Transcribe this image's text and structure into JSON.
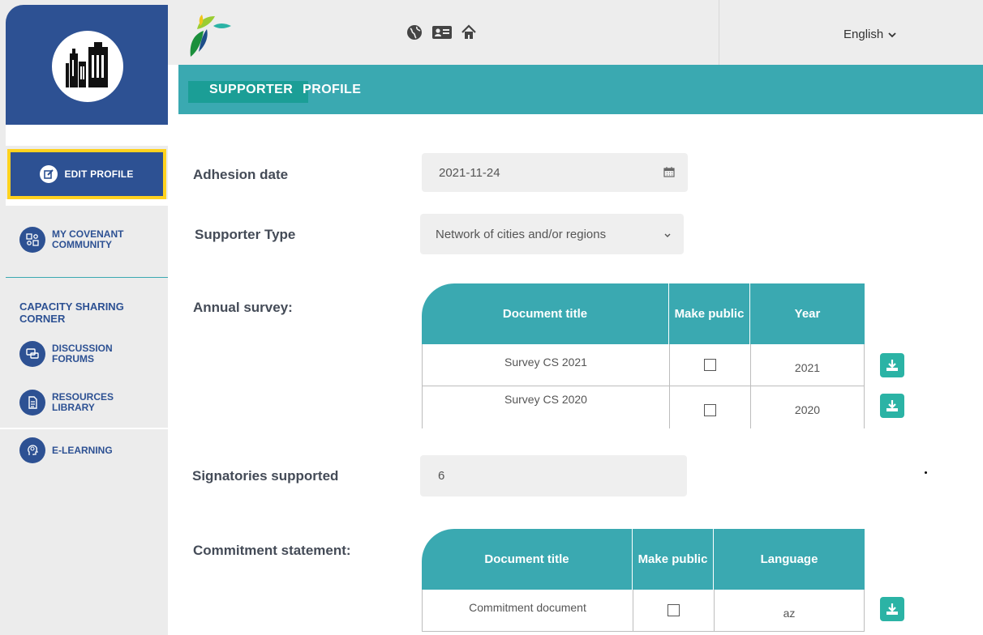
{
  "header": {
    "language": "English",
    "icons": [
      "globe-icon",
      "id-card-icon",
      "home-icon"
    ]
  },
  "title": {
    "part1": "SUPPORTER",
    "part2": "PROFILE"
  },
  "sidebar": {
    "edit_profile": "EDIT PROFILE",
    "my_covenant_community": "MY COVENANT COMMUNITY",
    "section_title": "CAPACITY SHARING CORNER",
    "discussion_forums": "DISCUSSION FORUMS",
    "resources_library": "RESOURCES LIBRARY",
    "e_learning": "E-LEARNING"
  },
  "form": {
    "adhesion_label": "Adhesion date",
    "adhesion_value": "2021-11-24",
    "supporter_type_label": "Supporter Type",
    "supporter_type_value": "Network of cities and/or regions",
    "annual_survey_label": "Annual survey:",
    "signatories_label": "Signatories supported",
    "signatories_value": "6",
    "commitment_label": "Commitment statement:"
  },
  "survey_table": {
    "headers": [
      "Document title",
      "Make public",
      "Year"
    ],
    "rows": [
      {
        "title": "Survey CS 2021",
        "year": "2021"
      },
      {
        "title": "Survey CS 2020",
        "year": "2020"
      }
    ]
  },
  "commitment_table": {
    "headers": [
      "Document title",
      "Make public",
      "Language"
    ],
    "rows": [
      {
        "title": "Commitment document",
        "language": "az"
      }
    ]
  },
  "colors": {
    "sidebar_blue": "#2d5193",
    "teal": "#3aa9b1",
    "highlight_yellow": "#ffd21f",
    "download_green": "#2bb3a5"
  }
}
